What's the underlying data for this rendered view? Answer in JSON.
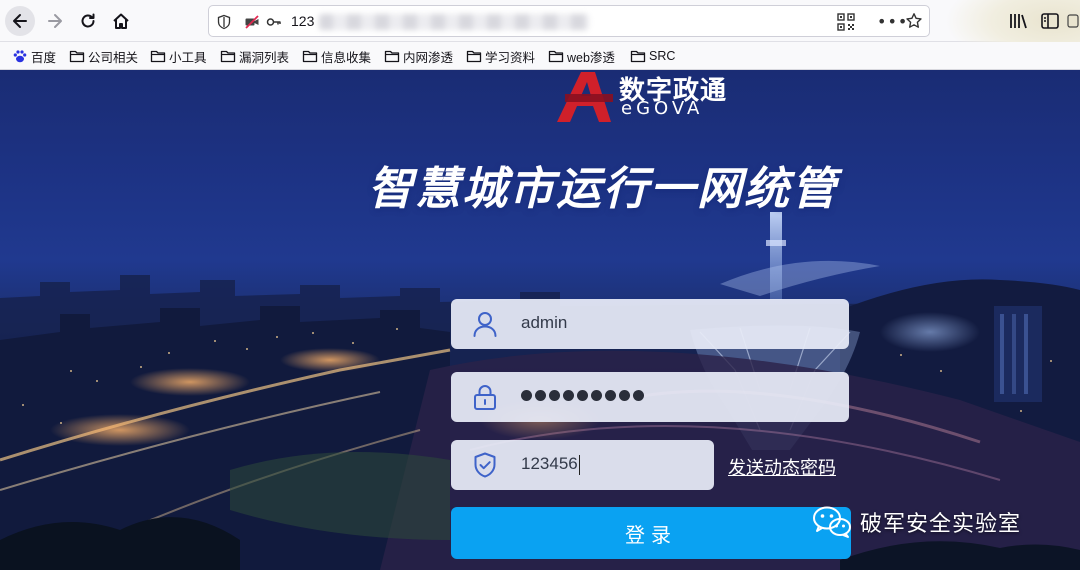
{
  "browser": {
    "url_text": "123",
    "bookmarks": [
      {
        "label": "百度",
        "icon": "baidu-paw-icon"
      },
      {
        "label": "公司相关",
        "icon": "folder-icon"
      },
      {
        "label": "小工具",
        "icon": "folder-icon"
      },
      {
        "label": "漏洞列表",
        "icon": "folder-icon"
      },
      {
        "label": "信息收集",
        "icon": "folder-icon"
      },
      {
        "label": "内网渗透",
        "icon": "folder-icon"
      },
      {
        "label": "学习资料",
        "icon": "folder-icon"
      },
      {
        "label": "web渗透",
        "icon": "folder-icon"
      },
      {
        "label": "SRC",
        "icon": "folder-icon"
      }
    ]
  },
  "page": {
    "logo": {
      "cn": "数字政通",
      "en": "eGOVA"
    },
    "title": "智慧城市运行一网统管",
    "form": {
      "username_value": "admin",
      "password_masked_count": 9,
      "code_value": "123456",
      "send_code_label": "发送动态密码",
      "login_label": "登录"
    },
    "watermark": "破军安全实验室"
  },
  "colors": {
    "login_button": "#0aa2f2",
    "background_top": "#1d3385",
    "logo_red": "#d0202a"
  }
}
